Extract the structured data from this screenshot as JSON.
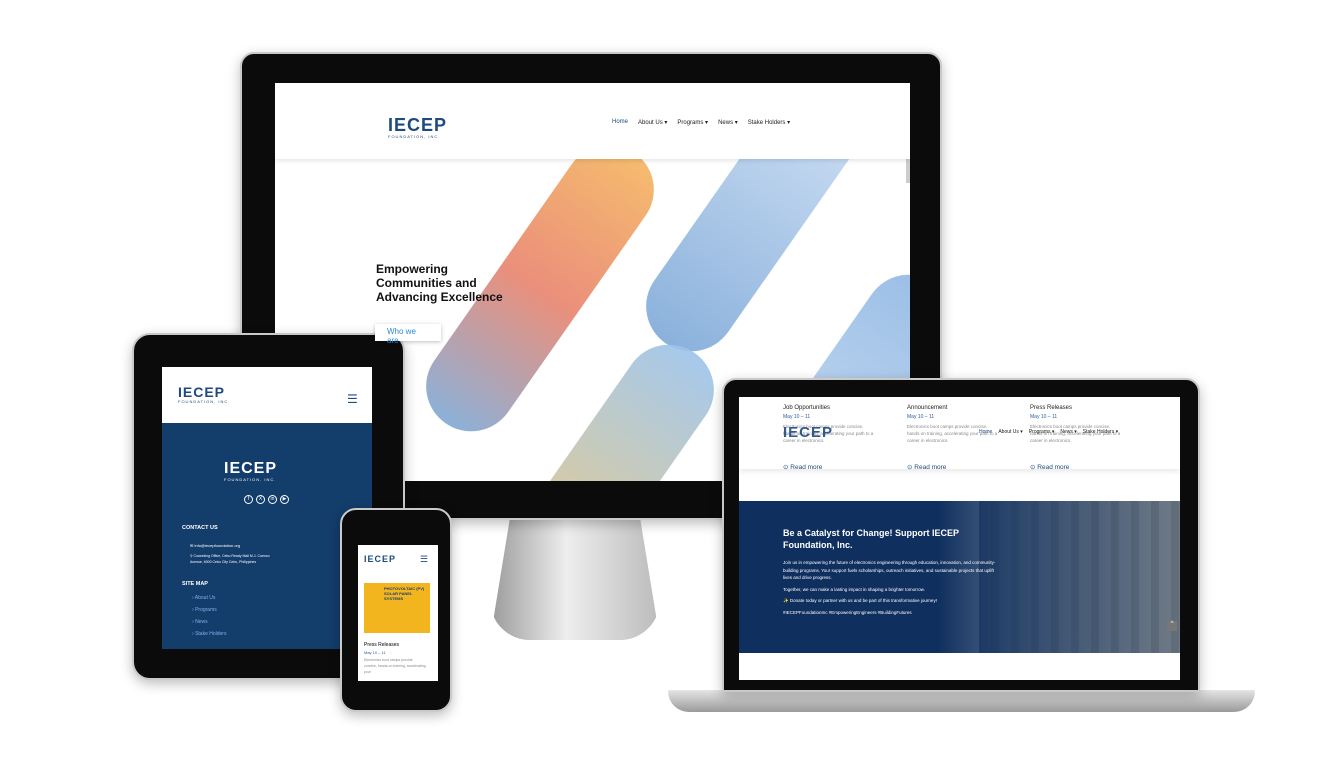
{
  "brand": {
    "logo_text": "IECEP",
    "logo_sub": "FOUNDATION, INC."
  },
  "nav": {
    "items": [
      "Home",
      "About Us ▾",
      "Programs ▾",
      "News ▾",
      "Stake Holders ▾"
    ]
  },
  "hero": {
    "title_lines": [
      "Empowering",
      "Communities and",
      "Advancing Excellence"
    ],
    "button": "Who we are"
  },
  "cards": [
    {
      "title": "Job Opportunities",
      "date": "May 10 – 11",
      "text": "Electronics boot camps provide concise, hands-on training, accelerating your path to a career in electronics.",
      "link": "Read more"
    },
    {
      "title": "Announcement",
      "date": "May 10 – 11",
      "text": "Electronics boot camps provide concise, hands-on training, accelerating your path to a career in electronics.",
      "link": "Read more"
    },
    {
      "title": "Press Releases",
      "date": "May 10 – 11",
      "text": "Electronics boot camps provide concise, hands-on training, accelerating your path to a career in electronics.",
      "link": "Read more"
    }
  ],
  "cta": {
    "title": "Be a Catalyst for Change! Support IECEP Foundation, Inc.",
    "p1": "Join us in empowering the future of electronics engineering through education, innovation, and community-building programs. Your support fuels scholarships, outreach initiatives, and sustainable projects that uplift lives and drive progress.",
    "p2": "Together, we can make a lasting impact in shaping a brighter tomorrow.",
    "p3": "Donate today or partner with us and be part of this transformative journey!",
    "tags": "#IECEPFoundationInc #EmpoweringEngineers #BuildingFutures"
  },
  "footer": {
    "contact_heading": "CONTACT US",
    "email": "info@iecepfoundation.org",
    "address": "Coworking Office, Cebu Ready Mall M.J. Cuenco Avenue, 6000 Cebu City Cebu, Philippines",
    "sitemap_heading": "SITE MAP",
    "sitemap": [
      "About Us",
      "Programs",
      "News",
      "Stake Holders"
    ],
    "social": [
      "facebook-icon",
      "x-icon",
      "linkedin-icon",
      "youtube-icon"
    ]
  },
  "phone": {
    "card_title": "Press Releases",
    "date": "May 10 – 11",
    "text": "Electronics boot camps provide concise, hands-on training, accelerating your",
    "poster": "PHOTOVOLTAIC (PV) SOLAR PANEL SYSTEMS"
  },
  "colors": {
    "navy": "#133d6b",
    "brand": "#1d4a7f",
    "link": "#2a5da0"
  }
}
